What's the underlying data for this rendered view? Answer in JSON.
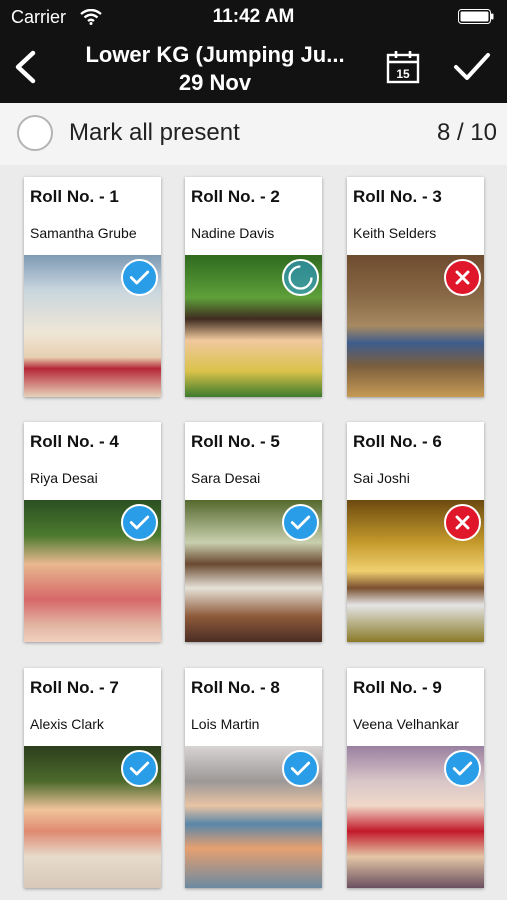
{
  "status": {
    "carrier": "Carrier",
    "time": "11:42 AM"
  },
  "header": {
    "title_line1": "Lower KG (Jumping Ju...",
    "title_line2": "29 Nov",
    "calendar_day": "15"
  },
  "mark_all": {
    "label": "Mark all present",
    "count": "8 / 10"
  },
  "colors": {
    "present": "#2a9de8",
    "absent": "#e0172b",
    "header_bg": "#121212"
  },
  "students": [
    {
      "roll": "Roll No. - 1",
      "name": "Samantha Grube",
      "status": "present"
    },
    {
      "roll": "Roll No. - 2",
      "name": "Nadine  Davis",
      "status": "loading"
    },
    {
      "roll": "Roll No. - 3",
      "name": "Keith  Selders",
      "status": "absent"
    },
    {
      "roll": "Roll No. - 4",
      "name": "Riya Desai",
      "status": "present"
    },
    {
      "roll": "Roll No. - 5",
      "name": "Sara Desai",
      "status": "present"
    },
    {
      "roll": "Roll No. - 6",
      "name": "Sai Joshi",
      "status": "absent"
    },
    {
      "roll": "Roll No. - 7",
      "name": "Alexis  Clark",
      "status": "present"
    },
    {
      "roll": "Roll No. - 8",
      "name": "Lois  Martin",
      "status": "present"
    },
    {
      "roll": "Roll No. - 9",
      "name": "Veena Velhankar",
      "status": "present"
    }
  ]
}
